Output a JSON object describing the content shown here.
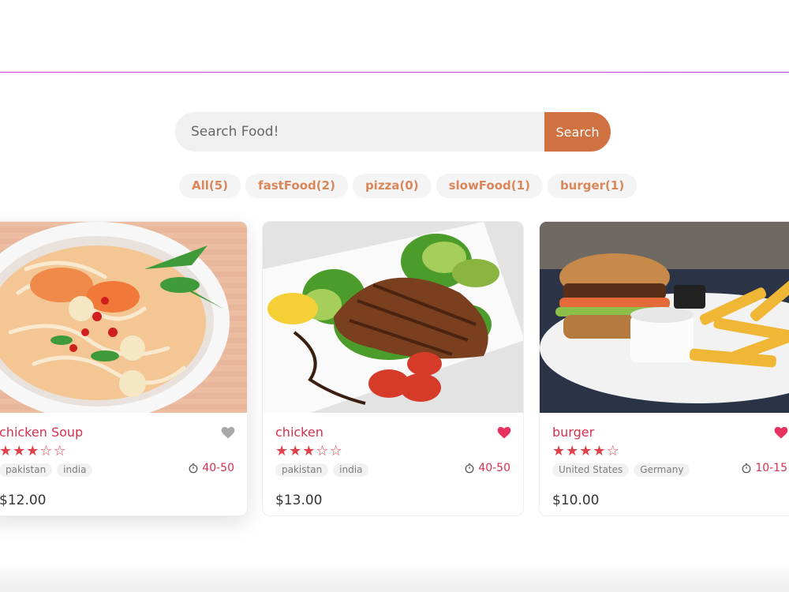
{
  "search": {
    "placeholder": "Search Food!",
    "button_label": "Search"
  },
  "tags": [
    {
      "label": "All(5)"
    },
    {
      "label": "fastFood(2)"
    },
    {
      "label": "pizza(0)"
    },
    {
      "label": "slowFood(1)"
    },
    {
      "label": "burger(1)"
    }
  ],
  "colors": {
    "accent": "#cf7140",
    "title": "#d6304f",
    "divider": "#c43fd4"
  },
  "foods": [
    {
      "name": "chicken Soup",
      "rating": 3,
      "max_rating": 5,
      "favorite": false,
      "origins": [
        "pakistan",
        "india"
      ],
      "cook_time": "40-50",
      "price": "$12.00",
      "image": "soup-image"
    },
    {
      "name": "chicken",
      "rating": 3,
      "max_rating": 5,
      "favorite": true,
      "origins": [
        "pakistan",
        "india"
      ],
      "cook_time": "40-50",
      "price": "$13.00",
      "image": "grilled-chicken-image"
    },
    {
      "name": "burger",
      "rating": 4,
      "max_rating": 5,
      "favorite": true,
      "origins": [
        "United States",
        "Germany"
      ],
      "cook_time": "10-15",
      "price": "$10.00",
      "image": "burger-image"
    }
  ]
}
